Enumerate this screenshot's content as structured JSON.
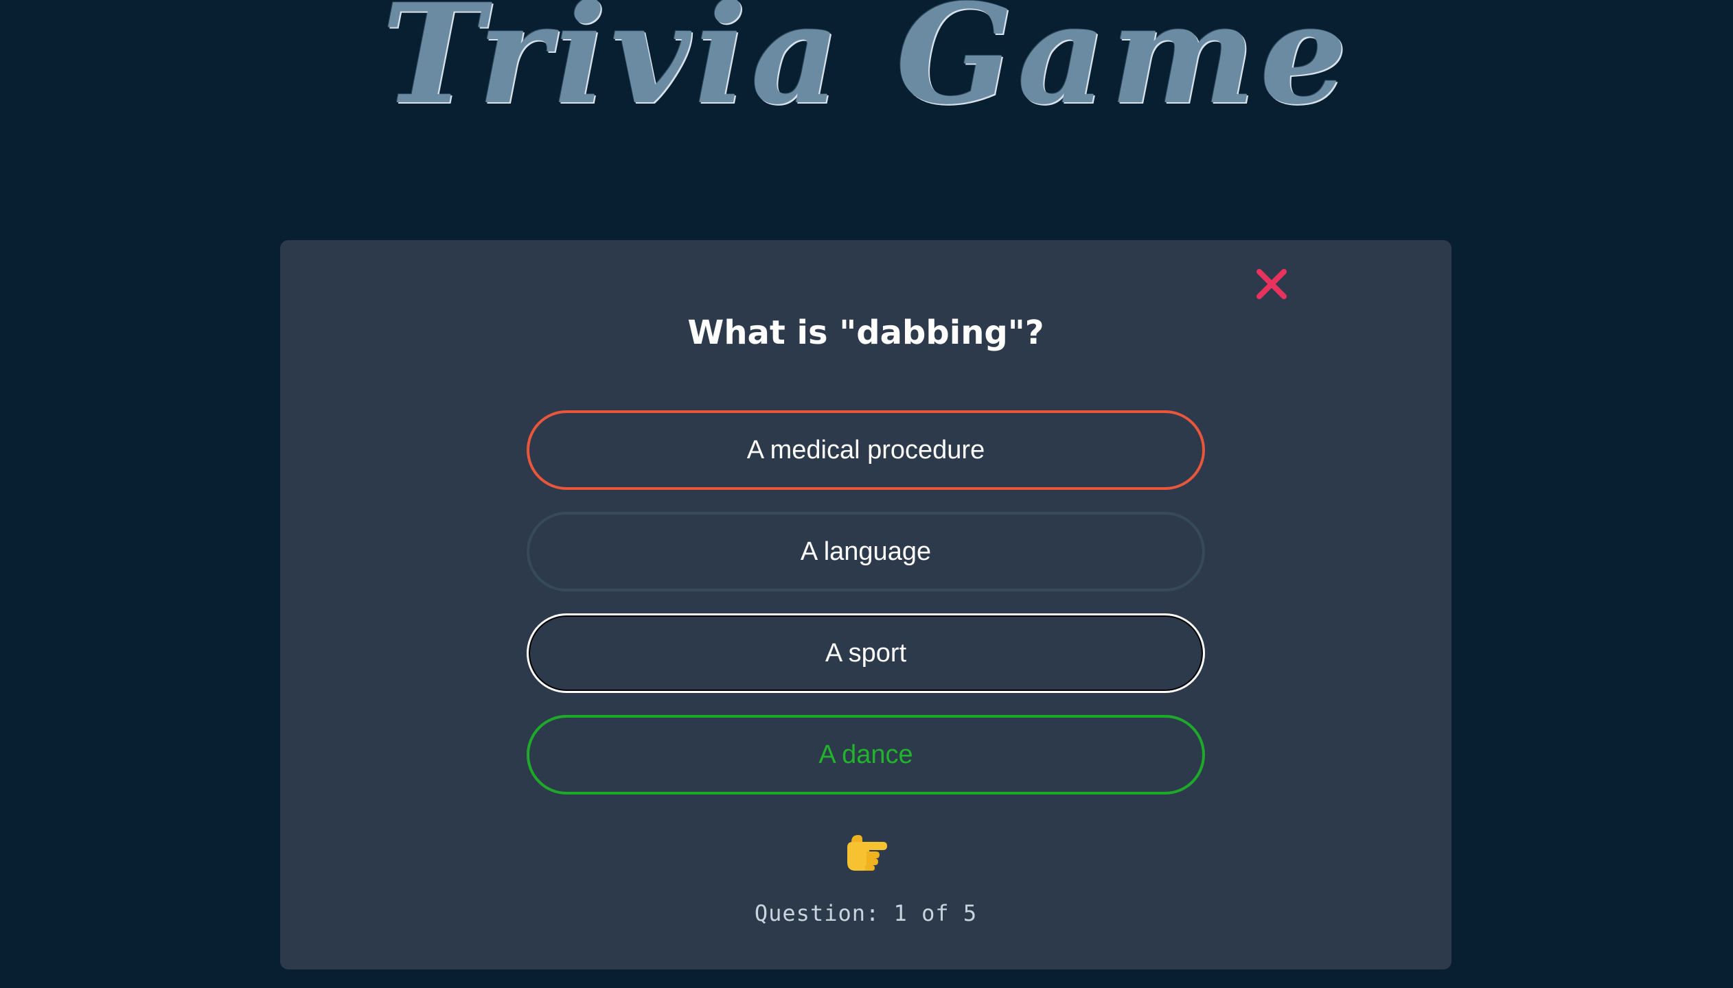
{
  "app": {
    "title": "Trivia Game"
  },
  "quiz": {
    "question": "What is \"dabbing\"?",
    "answers": [
      {
        "label": "A medical procedure",
        "state": "wrong"
      },
      {
        "label": "A language",
        "state": "neutral"
      },
      {
        "label": "A sport",
        "state": "selected"
      },
      {
        "label": "A dance",
        "state": "correct"
      }
    ],
    "progress_text": "Question: 1 of 5",
    "next_icon": "pointing-hand-icon",
    "close_icon": "close-x-icon"
  },
  "colors": {
    "background": "#081e31",
    "card": "#2d3a4b",
    "wrong": "#e8573c",
    "correct": "#1fa92a",
    "close": "#e8335e",
    "title": "#6b8ba3"
  }
}
